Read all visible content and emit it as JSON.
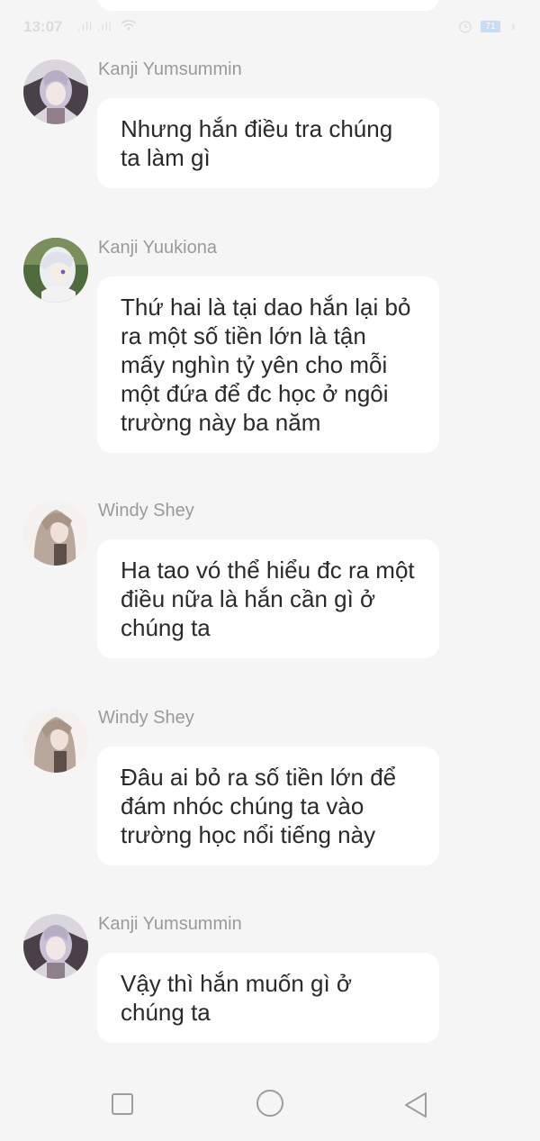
{
  "status_bar": {
    "time": "13:07",
    "signal": ".ıll .ıll",
    "battery": "71"
  },
  "messages": [
    {
      "sender": "Kanji Yumsummin",
      "text": "Nhưng hắn điều tra chúng ta làm gì"
    },
    {
      "sender": "Kanji Yuukiona",
      "text": "Thứ hai là tại dao hắn lại bỏ ra một số tiền lớn là tận mấy nghìn tỷ yên cho mỗi một đứa để đc học ở ngôi trường này ba năm"
    },
    {
      "sender": "Windy Shey",
      "text": "Ha tao vó thể hiểu đc ra một điều nữa là hắn cần gì ở chúng ta"
    },
    {
      "sender": "Windy Shey",
      "text": "Đâu ai bỏ ra số tiền lớn để đám nhóc chúng ta vào trường học nổi tiếng này"
    },
    {
      "sender": "Kanji Yumsummin",
      "text": "Vậy thì hắn muốn gì ở chúng ta"
    }
  ],
  "nav": {
    "recents_icon": "square-icon",
    "home_icon": "circle-icon",
    "back_icon": "triangle-back-icon"
  }
}
